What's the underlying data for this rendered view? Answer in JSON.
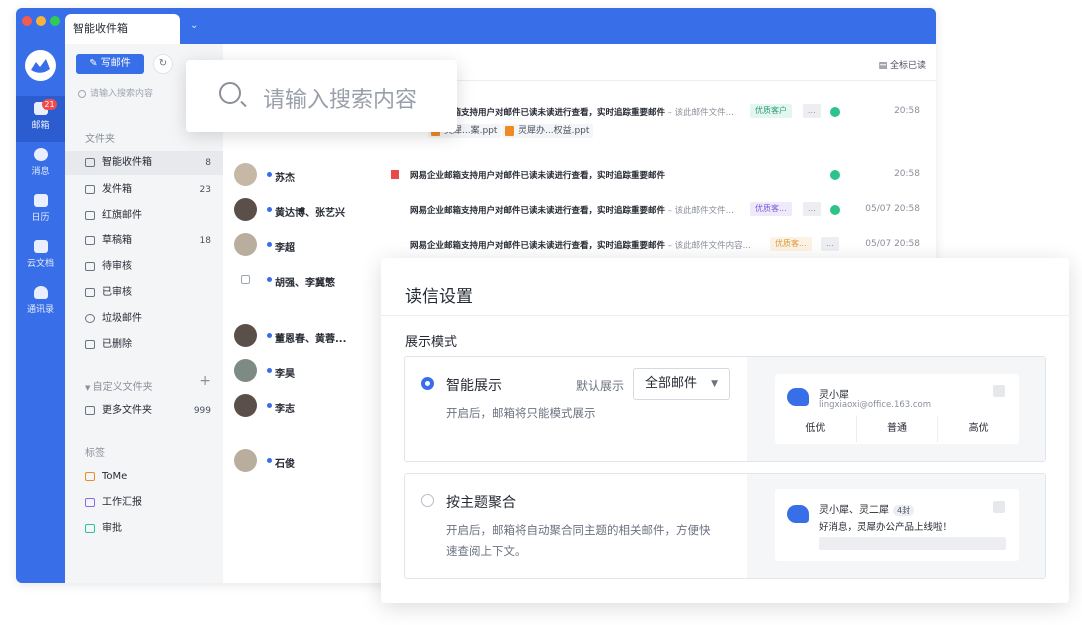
{
  "window": {
    "tab_title": "智能收件箱",
    "dots": [
      "#f35b52",
      "#f6b53a",
      "#2fcb55"
    ]
  },
  "rail": {
    "items": [
      {
        "label": "邮箱",
        "badge": "21"
      },
      {
        "label": "消息"
      },
      {
        "label": "日历"
      },
      {
        "label": "云文档"
      },
      {
        "label": "通讯录"
      }
    ]
  },
  "sidebar": {
    "compose_label": "写邮件",
    "search_placeholder": "请输入搜索内容",
    "folders_heading": "文件夹",
    "folders": [
      {
        "label": "智能收件箱",
        "count": "8"
      },
      {
        "label": "发件箱",
        "count": "23"
      },
      {
        "label": "红旗邮件",
        "count": ""
      },
      {
        "label": "草稿箱",
        "count": "18"
      },
      {
        "label": "待审核",
        "count": ""
      },
      {
        "label": "已审核",
        "count": ""
      },
      {
        "label": "垃圾邮件",
        "count": ""
      },
      {
        "label": "已删除",
        "count": ""
      }
    ],
    "custom_heading": "自定义文件夹",
    "custom": [
      {
        "label": "更多文件夹",
        "count": "999"
      }
    ],
    "tags_heading": "标签",
    "tags": [
      {
        "label": "ToMe"
      },
      {
        "label": "工作汇报"
      },
      {
        "label": "审批"
      }
    ]
  },
  "main": {
    "mark_all_read": "全标已读",
    "rows": [
      {
        "sender": "",
        "subject": "网易企业邮箱支持用户对邮件已读未读进行查看，实时追踪重要邮件",
        "summary": " – 该此邮件文件...",
        "tag": "优质客户",
        "time": "20:58",
        "attachments": [
          "灵犀...案.ppt",
          "灵犀办...权益.ppt"
        ]
      },
      {
        "sender": "苏杰",
        "subject": "网易企业邮箱支持用户对邮件已读未读进行查看，实时追踪重要邮件",
        "summary": "",
        "tag": "",
        "time": "20:58"
      },
      {
        "sender": "黄达博、张艺兴",
        "subject": "网易企业邮箱支持用户对邮件已读未读进行查看，实时追踪重要邮件",
        "summary": " – 该此邮件文件...",
        "tag": "优质客...",
        "time": "05/07 20:58"
      },
      {
        "sender": "李超",
        "subject": "网易企业邮箱支持用户对邮件已读未读进行查看，实时追踪重要邮件",
        "summary": " – 该此邮件文件内容...",
        "tag": "优质客...",
        "time": "05/07 20:58"
      },
      {
        "sender": "胡强、李冀慜"
      },
      {
        "sender": "董恩春、黄蓉..."
      },
      {
        "sender": "李昊"
      },
      {
        "sender": "李志"
      },
      {
        "sender": "石俊"
      }
    ],
    "more_label": "..."
  },
  "search_popup": {
    "placeholder": "请输入搜索内容"
  },
  "settings": {
    "title": "读信设置",
    "section": "展示模式",
    "option1": {
      "title": "智能展示",
      "desc": "开启后，邮箱将只能模式展示",
      "default_label": "默认展示",
      "select_value": "全部邮件"
    },
    "option2": {
      "title": "按主题聚合",
      "desc_line1": "开启后，邮箱将自动聚合同主题的相关邮件，方便快",
      "desc_line2": "速查阅上下文。"
    },
    "preview1": {
      "name": "灵小犀",
      "email": "lingxiaoxi@office.163.com",
      "tabs": [
        "低优",
        "普通",
        "高优"
      ]
    },
    "preview2": {
      "name": "灵小犀、灵二犀",
      "badge": "4封",
      "message": "好消息，灵犀办公产品上线啦！"
    }
  },
  "colors": {
    "accent": "#386ee7",
    "sidebar_bg": "#f4f5f7"
  }
}
